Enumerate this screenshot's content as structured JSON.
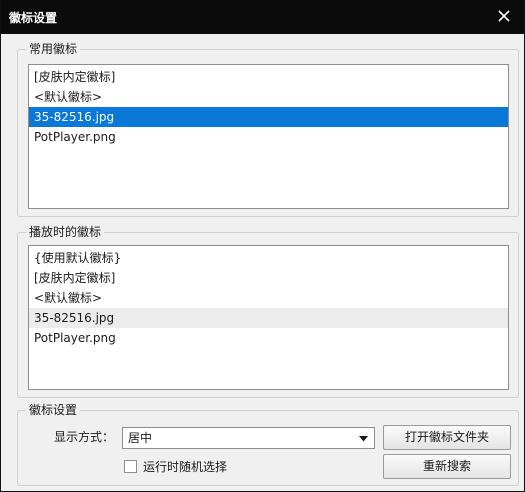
{
  "window": {
    "title": "徽标设置"
  },
  "common_logos": {
    "title": "常用徽标",
    "items": [
      "[皮肤内定徽标]",
      "<默认徽标>",
      "35-82516.jpg",
      "PotPlayer.png"
    ],
    "selected_index": 2
  },
  "playback_logos": {
    "title": "播放时的徽标",
    "items": [
      "{使用默认徽标}",
      "[皮肤内定徽标]",
      "<默认徽标>",
      "35-82516.jpg",
      "PotPlayer.png"
    ],
    "highlighted_index": 3
  },
  "logo_settings": {
    "title": "徽标设置",
    "display_mode_label": "显示方式：",
    "display_mode_value": "居中",
    "open_folder_button": "打开徽标文件夹",
    "random_checkbox_label": "运行时随机选择",
    "random_checked": false,
    "rescan_button": "重新搜索"
  },
  "colors": {
    "titlebar": "#0b0b0b",
    "selection": "#0a78d7",
    "background": "#f0f0f0"
  }
}
